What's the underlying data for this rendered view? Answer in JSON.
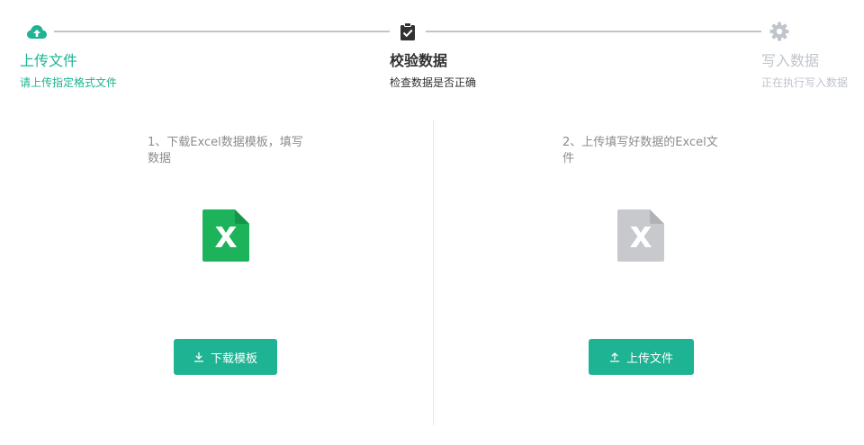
{
  "steps": [
    {
      "title": "上传文件",
      "desc": "请上传指定格式文件",
      "icon": "cloud-upload-icon",
      "state": "done"
    },
    {
      "title": "校验数据",
      "desc": "检查数据是否正确",
      "icon": "clipboard-check-icon",
      "state": "current"
    },
    {
      "title": "写入数据",
      "desc": "正在执行写入数据",
      "icon": "gear-icon",
      "state": "pending"
    }
  ],
  "left_panel": {
    "instruction": "1、下载Excel数据模板，填写数据",
    "icon": "excel-file-icon",
    "button_label": "下载模板",
    "button_icon": "download-icon"
  },
  "right_panel": {
    "instruction": "2、上传填写好数据的Excel文件",
    "icon": "excel-file-disabled-icon",
    "button_label": "上传文件",
    "button_icon": "upload-icon"
  },
  "colors": {
    "accent": "#1db393",
    "excel_green": "#1db35a",
    "disabled": "#c0c4cc",
    "text_dark": "#303133",
    "text_muted": "#8c8c8c"
  }
}
